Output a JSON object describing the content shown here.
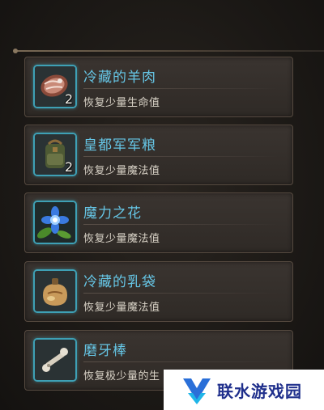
{
  "inventory": {
    "items": [
      {
        "name": "冷藏的羊肉",
        "desc": "恢复少量生命值",
        "qty": "2",
        "icon": "raw-mutton-icon"
      },
      {
        "name": "皇都军军粮",
        "desc": "恢复少量魔法值",
        "qty": "2",
        "icon": "ration-backpack-icon"
      },
      {
        "name": "魔力之花",
        "desc": "恢复少量魔法值",
        "qty": "",
        "icon": "blue-flower-icon"
      },
      {
        "name": "冷藏的乳袋",
        "desc": "恢复少量魔法值",
        "qty": "",
        "icon": "milk-pouch-icon"
      },
      {
        "name": "磨牙棒",
        "desc": "恢复极少量的生",
        "qty": "",
        "icon": "bone-stick-icon"
      }
    ]
  },
  "watermark": {
    "text": "联水游戏园"
  },
  "colors": {
    "item_name": "#66c6e6",
    "frame_border": "#3ea0b5",
    "desc": "#d8d2c6"
  }
}
